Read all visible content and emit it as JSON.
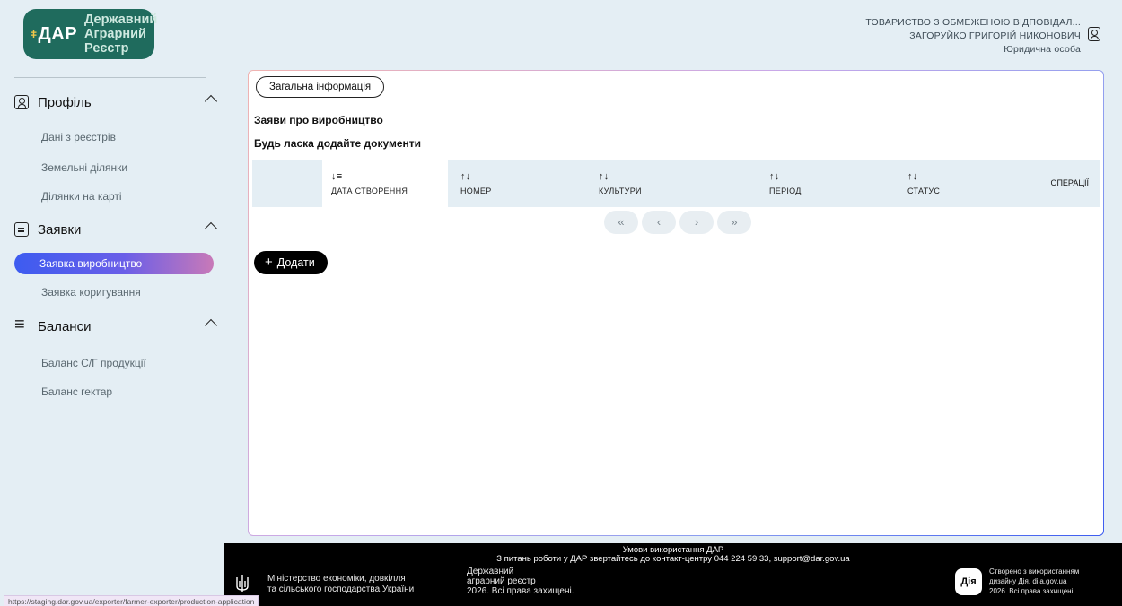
{
  "header": {
    "logo_short": "ДАР",
    "logo_line1": "Державний",
    "logo_line2": "Аграрний",
    "logo_line3": "Реєстр",
    "company": "ТОВАРИСТВО З ОБМЕЖЕНОЮ ВІДПОВІДАЛ...",
    "person": "ЗАГОРУЙКО ГРИГОРІЙ НИКОНОВИЧ",
    "entity_type": "Юридична особа"
  },
  "sidebar": {
    "profile": {
      "label": "Профіль",
      "items": [
        "Дані з реєстрів",
        "Земельні ділянки",
        "Ділянки на карті"
      ]
    },
    "applications": {
      "label": "Заявки",
      "items": [
        "Заявка виробництво",
        "Заявка коригування"
      ],
      "active_index": 0
    },
    "balances": {
      "label": "Баланси",
      "items": [
        "Баланс С/Г продукції",
        "Баланс гектар"
      ]
    }
  },
  "main": {
    "tab_label": "Загальна інформація",
    "title": "Заяви про виробництво",
    "subtitle": "Будь ласка додайте документи",
    "table": {
      "columns": [
        "ДАТА СТВОРЕННЯ",
        "НОМЕР",
        "КУЛЬТУРИ",
        "ПЕРІОД",
        "СТАТУС"
      ],
      "operations_label": "ОПЕРАЦІЇ",
      "sort_icon_first": "↓≡",
      "sort_icon": "↑↓",
      "rows": []
    },
    "pager": {
      "first": "«",
      "prev": "‹",
      "next": "›",
      "last": "»"
    },
    "add_button": {
      "plus": "+",
      "label": "Додати"
    }
  },
  "footer": {
    "terms": "Умови використання ДАР",
    "support": "З питань роботи у ДАР звертайтесь до контакт-центру 044 224 59 33, support@dar.gov.ua",
    "ministry_line1": "Міністерство економіки, довкілля",
    "ministry_line2": "та сільського господарства України",
    "registry_line1": "Державний",
    "registry_line2": "аграрний реєстр",
    "registry_line3": "2026. Всі права захищені.",
    "diia_logo": "Дія",
    "diia_line1": "Створено з використанням",
    "diia_line2": "дизайну Дія. diia.gov.ua",
    "diia_line3": "2026. Всі права захищені."
  },
  "status_url": "https://staging.dar.gov.ua/exporter/farmer-exporter/production-application"
}
